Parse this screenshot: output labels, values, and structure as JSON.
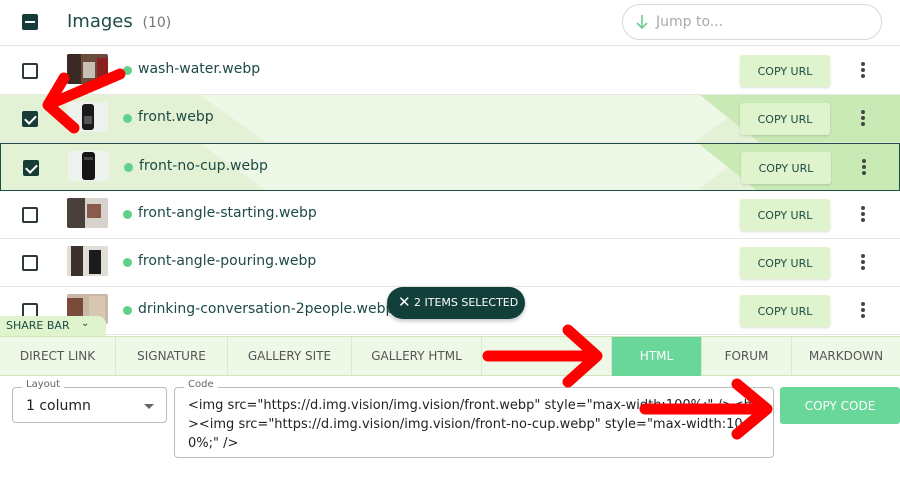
{
  "header": {
    "title": "Images",
    "count": "(10)",
    "jump_placeholder": "Jump to..."
  },
  "rows": [
    {
      "name": "wash-water.webp",
      "checked": false,
      "copy_label": "COPY URL"
    },
    {
      "name": "front.webp",
      "checked": true,
      "copy_label": "COPY URL"
    },
    {
      "name": "front-no-cup.webp",
      "checked": true,
      "copy_label": "COPY URL"
    },
    {
      "name": "front-angle-starting.webp",
      "checked": false,
      "copy_label": "COPY URL"
    },
    {
      "name": "front-angle-pouring.webp",
      "checked": false,
      "copy_label": "COPY URL"
    },
    {
      "name": "drinking-conversation-2people.webp",
      "checked": false,
      "copy_label": "COPY URL"
    }
  ],
  "selection_pill": "2 ITEMS SELECTED",
  "share_bar": {
    "label": "SHARE BAR",
    "tabs": [
      "DIRECT LINK",
      "SIGNATURE",
      "GALLERY SITE",
      "GALLERY HTML",
      "",
      "HTML",
      "FORUM",
      "MARKDOWN"
    ],
    "active_tab": "HTML"
  },
  "layout_field": {
    "legend": "Layout",
    "value": "1 column"
  },
  "code_field": {
    "legend": "Code",
    "value": "<img src=\"https://d.img.vision/img.vision/front.webp\" style=\"max-width:100%;\" /><br/><img src=\"https://d.img.vision/img.vision/front-no-cup.webp\" style=\"max-width:100%;\" />"
  },
  "copy_code_label": "COPY CODE",
  "colors": {
    "accent_green": "#68d799",
    "selected_row": "#e3f2d4",
    "dark_teal": "#123f3a",
    "annotation_red": "#ff0000"
  },
  "icons": [
    "minus-checkbox-icon",
    "arrow-down-icon",
    "status-dot-icon",
    "more-vert-icon",
    "close-icon",
    "chevron-down-icon",
    "dropdown-caret-icon"
  ]
}
